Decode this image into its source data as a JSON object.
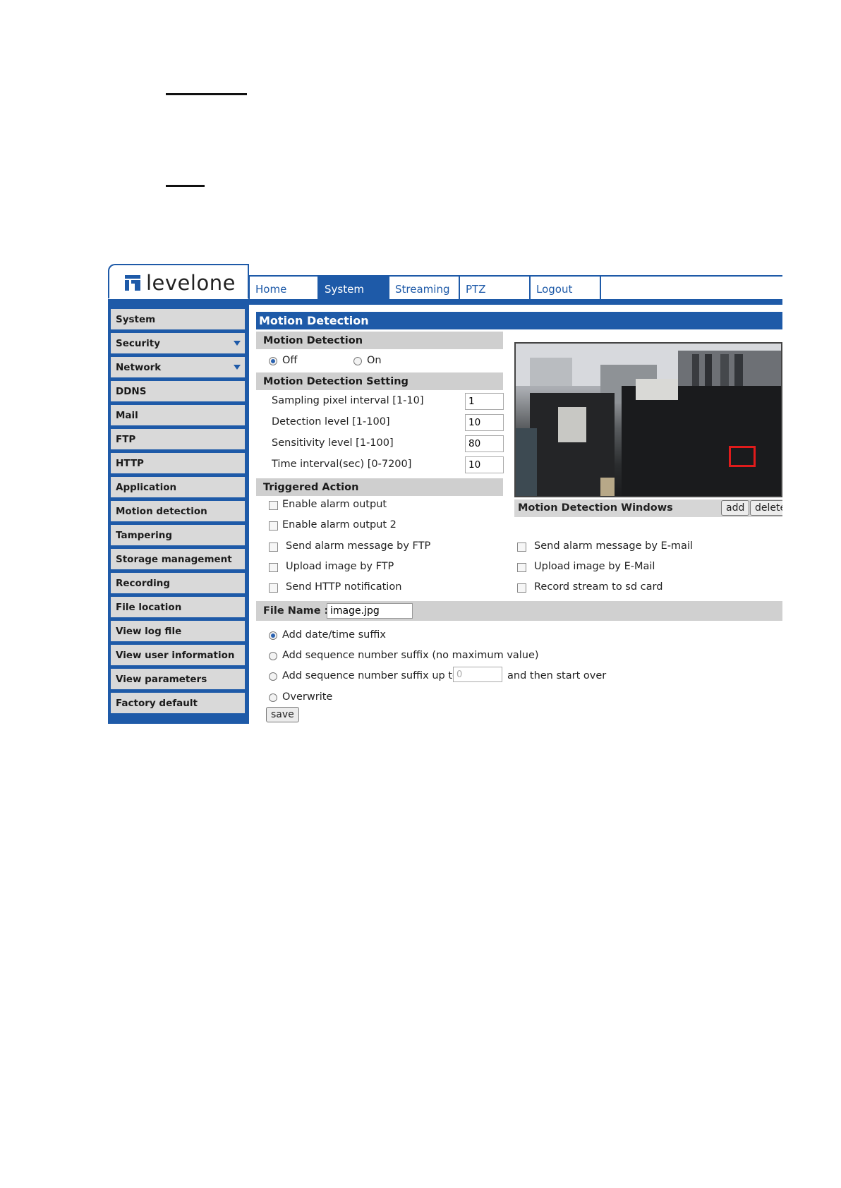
{
  "logo": {
    "text": "levelone"
  },
  "nav": {
    "tabs": [
      "Home",
      "System",
      "Streaming",
      "PTZ",
      "Logout"
    ],
    "active": "System"
  },
  "sidebar": {
    "items": [
      {
        "label": "System",
        "arrow": false
      },
      {
        "label": "Security",
        "arrow": true
      },
      {
        "label": "Network",
        "arrow": true
      },
      {
        "label": "DDNS",
        "arrow": false
      },
      {
        "label": "Mail",
        "arrow": false
      },
      {
        "label": "FTP",
        "arrow": false
      },
      {
        "label": "HTTP",
        "arrow": false
      },
      {
        "label": "Application",
        "arrow": false
      },
      {
        "label": "Motion detection",
        "arrow": false
      },
      {
        "label": "Tampering",
        "arrow": false
      },
      {
        "label": "Storage management",
        "arrow": false
      },
      {
        "label": "Recording",
        "arrow": false
      },
      {
        "label": "File location",
        "arrow": false
      },
      {
        "label": "View log file",
        "arrow": false
      },
      {
        "label": "View user information",
        "arrow": false
      },
      {
        "label": "View parameters",
        "arrow": false
      },
      {
        "label": "Factory default",
        "arrow": false
      }
    ]
  },
  "main": {
    "title": "Motion Detection",
    "motion_detection": {
      "header": "Motion Detection",
      "off_label": "Off",
      "on_label": "On",
      "selected": "Off"
    },
    "setting": {
      "header": "Motion Detection Setting",
      "fields": [
        {
          "label": "Sampling pixel interval [1-10]",
          "value": "1"
        },
        {
          "label": "Detection level [1-100]",
          "value": "10"
        },
        {
          "label": "Sensitivity level [1-100]",
          "value": "80"
        },
        {
          "label": "Time interval(sec) [0-7200]",
          "value": "10"
        }
      ]
    },
    "triggered": {
      "header": "Triggered Action",
      "enable_alarm_output": "Enable alarm output",
      "enable_alarm_output_2": "Enable alarm output 2",
      "left": [
        "Send alarm message by FTP",
        "Upload image by FTP",
        "Send HTTP notification"
      ],
      "right": [
        "Send alarm message by E-mail",
        "Upload image by E-Mail",
        "Record stream to sd card"
      ]
    },
    "windows": {
      "title": "Motion Detection Windows",
      "add": "add",
      "delete": "delete"
    },
    "file": {
      "label": "File Name :",
      "value": "image.jpg",
      "options": [
        "Add date/time suffix",
        "Add sequence number suffix (no maximum value)",
        "Add sequence number suffix up to",
        "Overwrite"
      ],
      "upto_value": "0",
      "start_over": "and then start over",
      "selected_index": 0
    },
    "save": "save"
  },
  "colors": {
    "brand_blue": "#1e5aa8",
    "section_gray": "#cfcfcf",
    "motion_window": "#e01b1b"
  }
}
